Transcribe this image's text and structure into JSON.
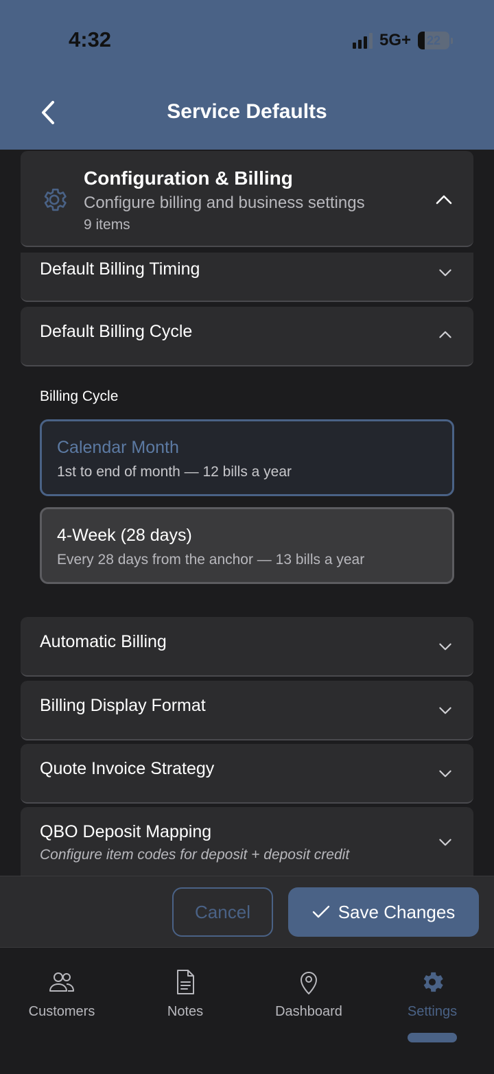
{
  "status_bar": {
    "time": "4:32",
    "network": "5G+",
    "battery": "22",
    "battery_level": 0.22
  },
  "header": {
    "title": "Service Defaults",
    "back_icon": "chevron-left-icon",
    "background": "#4a6286"
  },
  "section": {
    "title": "Configuration & Billing",
    "subtitle": "Configure billing and business settings",
    "count": "9 items",
    "icon": "gear-icon",
    "expanded": true
  },
  "items": [
    {
      "label": "Default Billing Timing",
      "expanded": false
    },
    {
      "label": "Default Billing Cycle",
      "expanded": true
    },
    {
      "label": "Automatic Billing",
      "expanded": false
    },
    {
      "label": "Billing Display Format",
      "expanded": false
    },
    {
      "label": "Quote Invoice Strategy",
      "expanded": false
    },
    {
      "label": "QBO Deposit Mapping",
      "subtitle": "Configure item codes for deposit + deposit credit",
      "expanded": false
    }
  ],
  "billing_cycle": {
    "label": "Billing Cycle",
    "options": [
      {
        "title": "Calendar Month",
        "description": "1st to end of month — 12 bills a year",
        "selected": true
      },
      {
        "title": "4-Week (28 days)",
        "description": "Every 28 days from the anchor — 13 bills a year",
        "selected": false
      }
    ]
  },
  "actions": {
    "cancel_label": "Cancel",
    "save_label": "Save Changes",
    "accent": "#4a6286"
  },
  "bottom_nav": {
    "items": [
      {
        "label": "Customers",
        "icon": "users-icon",
        "active": false
      },
      {
        "label": "Notes",
        "icon": "document-icon",
        "active": false
      },
      {
        "label": "Dashboard",
        "icon": "map-pin-icon",
        "active": false
      },
      {
        "label": "Settings",
        "icon": "gear-icon",
        "active": true
      }
    ]
  }
}
